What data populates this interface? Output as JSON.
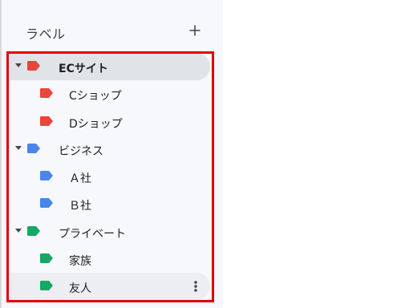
{
  "header": {
    "title": "ラベル",
    "add_icon": "plus-icon"
  },
  "labels": [
    {
      "name": "ECサイト",
      "level": 0,
      "expandable": true,
      "selected": true,
      "color": "#e8453c"
    },
    {
      "name": "Cショップ",
      "level": 1,
      "expandable": false,
      "selected": false,
      "color": "#e8453c"
    },
    {
      "name": "Dショップ",
      "level": 1,
      "expandable": false,
      "selected": false,
      "color": "#e8453c"
    },
    {
      "name": "ビジネス",
      "level": 0,
      "expandable": true,
      "selected": false,
      "color": "#4a86e8"
    },
    {
      "name": "Ａ社",
      "level": 1,
      "expandable": false,
      "selected": false,
      "color": "#4a86e8"
    },
    {
      "name": "Ｂ社",
      "level": 1,
      "expandable": false,
      "selected": false,
      "color": "#4a86e8"
    },
    {
      "name": "プライベート",
      "level": 0,
      "expandable": true,
      "selected": false,
      "color": "#16a765"
    },
    {
      "name": "家族",
      "level": 1,
      "expandable": false,
      "selected": false,
      "color": "#16a765"
    },
    {
      "name": "友人",
      "level": 1,
      "expandable": false,
      "selected": false,
      "hovered": true,
      "color": "#16a765"
    }
  ],
  "highlight_color": "#e00000"
}
